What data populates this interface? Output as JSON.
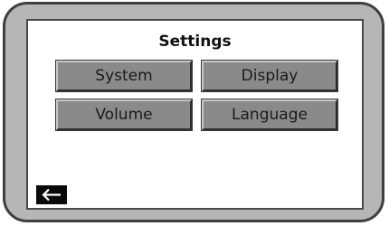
{
  "screen": {
    "title": "Settings"
  },
  "menu": {
    "items": [
      {
        "label": "System"
      },
      {
        "label": "Display"
      },
      {
        "label": "Volume"
      },
      {
        "label": "Language"
      }
    ]
  },
  "navigation": {
    "back_icon": "left-arrow-icon"
  },
  "colors": {
    "bezel": "#b6b6b6",
    "bezel_border": "#3f3f3f",
    "screen_background": "#ffffff",
    "button_face": "#8a8a8a",
    "back_button": "#0a0a0a"
  }
}
